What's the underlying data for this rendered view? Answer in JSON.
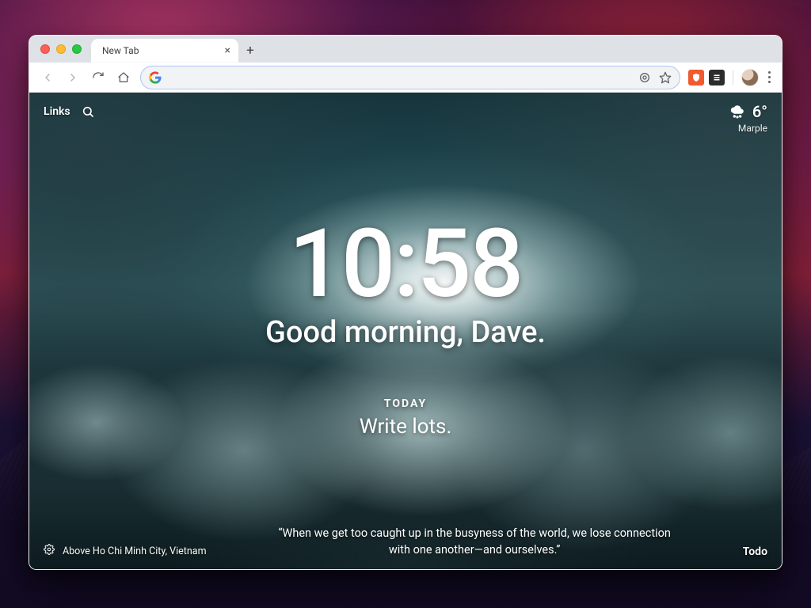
{
  "tab": {
    "title": "New Tab"
  },
  "toolbar": {
    "omnibox_value": ""
  },
  "newtab": {
    "links_label": "Links",
    "weather": {
      "temp": "6°",
      "location": "Marple",
      "condition": "snow"
    },
    "clock": "10:58",
    "greeting": "Good morning, Dave.",
    "focus": {
      "label": "TODAY",
      "text": "Write lots."
    },
    "photo_caption": "Above Ho Chi Minh City, Vietnam",
    "quote": "“When we get too caught up in the busyness of the world, we lose connection with one another—and ourselves.”",
    "todo_label": "Todo"
  }
}
